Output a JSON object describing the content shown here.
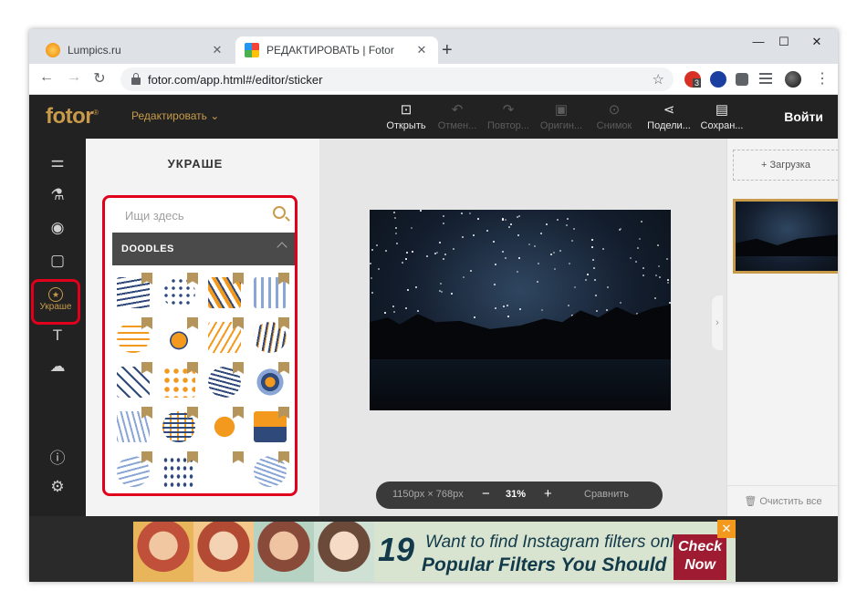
{
  "browser": {
    "tabs": [
      {
        "title": "Lumpics.ru",
        "close": "✕"
      },
      {
        "title": "РЕДАКТИРОВАТЬ | Fotor",
        "close": "✕"
      }
    ],
    "new_tab": "+",
    "window_controls": {
      "minimize": "—",
      "maximize": "☐",
      "close": "✕"
    },
    "url": "fotor.com/app.html#/editor/sticker",
    "extension_badge": "3"
  },
  "app": {
    "logo": "fotor",
    "logo_mark": "®",
    "edit_menu": "Редактировать",
    "tools": [
      {
        "label": "Открыть",
        "icon": "open-image-icon",
        "enabled": true
      },
      {
        "label": "Отмен...",
        "icon": "undo-icon",
        "enabled": false
      },
      {
        "label": "Повтор...",
        "icon": "redo-icon",
        "enabled": false
      },
      {
        "label": "Оригин...",
        "icon": "original-icon",
        "enabled": false
      },
      {
        "label": "Снимок",
        "icon": "snapshot-icon",
        "enabled": false
      },
      {
        "label": "Подели...",
        "icon": "share-icon",
        "enabled": true
      },
      {
        "label": "Сохран...",
        "icon": "save-icon",
        "enabled": true
      }
    ],
    "login": "Войти",
    "sidebar": {
      "active_label": "Украше",
      "items": [
        "adjust-icon",
        "beauty-icon",
        "eye-icon",
        "frame-icon",
        "sticker-icon",
        "text-icon",
        "cloud-icon",
        "help-icon",
        "settings-icon"
      ]
    },
    "panel": {
      "title": "УКРАШЕ",
      "search_placeholder": "Ищи здесь",
      "category": "DOODLES",
      "sticker_count": 20
    },
    "canvas": {
      "size": "1150px × 768px",
      "zoom_out": "−",
      "zoom": "31%",
      "zoom_in": "+",
      "compare": "Сравнить"
    },
    "right": {
      "upload": "+ Загрузка",
      "clear_all": "Очистить все"
    }
  },
  "ad": {
    "number": "19",
    "line1": "Want to find Instagram filters online?",
    "line2": "Popular Filters You Should Try",
    "cta": "Check Now",
    "close": "✕"
  },
  "colors": {
    "fotor_gold": "#c89b4a",
    "highlight_red": "#e0001b",
    "app_dark": "#222222"
  }
}
